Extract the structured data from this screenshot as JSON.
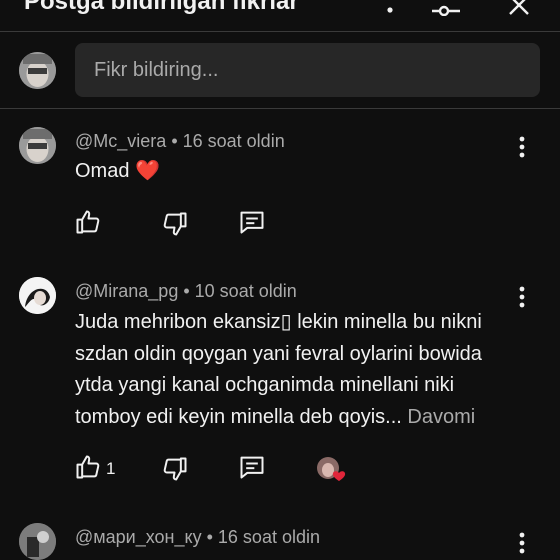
{
  "header": {
    "title": "Postga bildirilgan fikrlar"
  },
  "composer": {
    "placeholder": "Fikr bildiring..."
  },
  "comments": [
    {
      "author": "@Mc_viera",
      "time": "16 soat oldin",
      "text": "Omad ❤️",
      "likes": ""
    },
    {
      "author": "@Mirana_pg",
      "time": "10 soat oldin",
      "lines": [
        "Juda mehribon ekansiz▯ lekin minella bu nikni",
        "szdan oldin qoygan yani fevral oylarini bowida",
        "ytda yangi kanal ochganimda minellani niki",
        "tomboy edi keyin minella deb qoyis..."
      ],
      "read_more": "Davomi",
      "likes": "1"
    },
    {
      "author": "@мари_хон_ку",
      "time": "16 soat oldin"
    }
  ],
  "colors": {
    "background": "#0f0f0f",
    "input": "#272727",
    "secondary_text": "#aaaaaa",
    "heart": "#e0253a"
  },
  "icons": [
    "more-vert-icon",
    "filter-icon",
    "close-icon",
    "like-icon",
    "dislike-icon",
    "reply-icon",
    "creator-heart-icon"
  ]
}
